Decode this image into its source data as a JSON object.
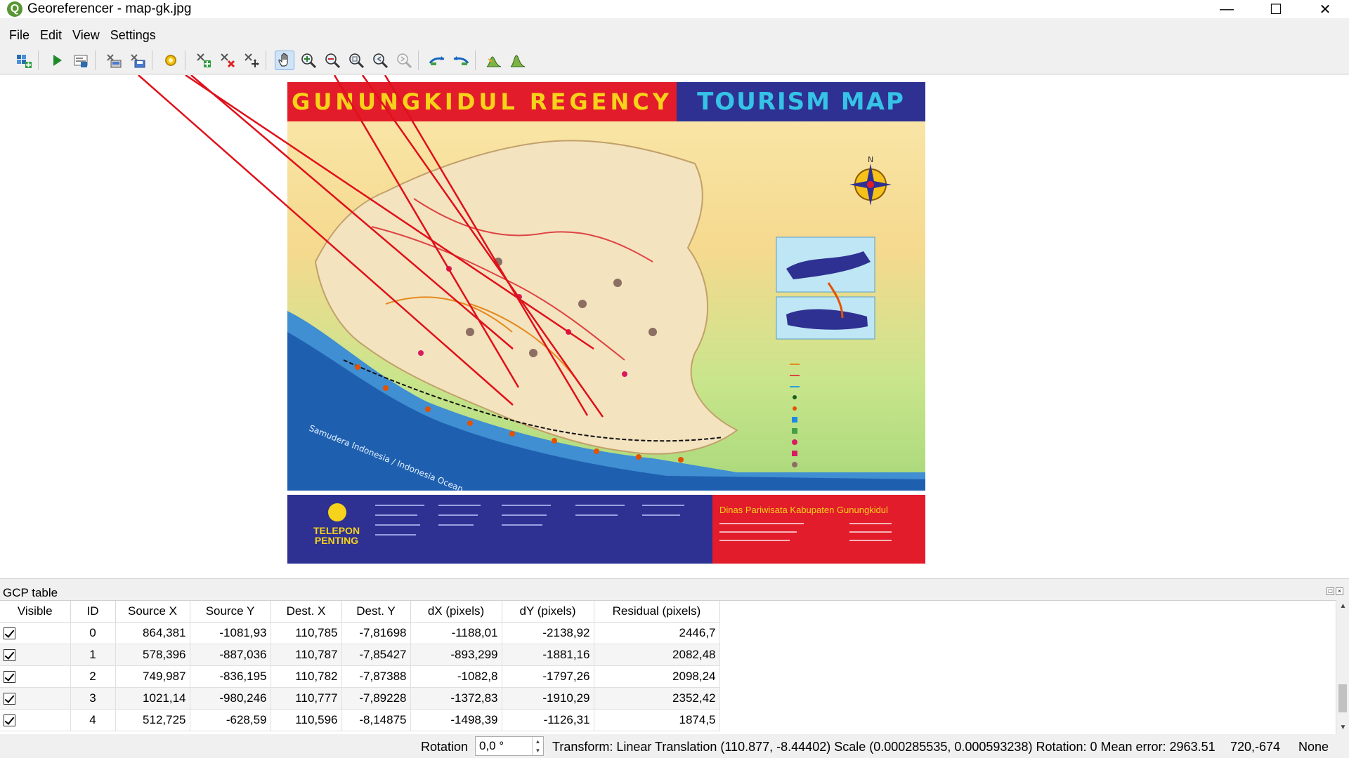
{
  "window": {
    "title": "Georeferencer - map-gk.jpg",
    "app_icon": "qgis-icon",
    "controls": [
      "minimize-icon",
      "maximize-icon",
      "close-icon"
    ]
  },
  "menu": [
    "File",
    "Edit",
    "View",
    "Settings"
  ],
  "toolbar": {
    "buttons": [
      "open-raster-icon",
      "start-georeferencing-icon",
      "generate-gdal-script-icon",
      "load-gcp-points-icon",
      "save-gcp-points-icon",
      "transformation-settings-icon",
      "add-point-icon",
      "delete-point-icon",
      "move-gcp-point-icon",
      "pan-icon",
      "zoom-in-icon",
      "zoom-out-icon",
      "zoom-to-layer-icon",
      "zoom-last-icon",
      "zoom-next-icon",
      "link-georef-to-qgis-icon",
      "link-qgis-to-georef-icon",
      "full-histogram-stretch-icon",
      "local-histogram-stretch-icon"
    ],
    "active": "pan-icon"
  },
  "map": {
    "title_left": "GUNUNGKIDUL REGENCY",
    "title_right": "TOURISM MAP",
    "telepon": "TELEPON PENTING",
    "dinas": "Dinas Pariwisata Kabupaten Gunungkidul",
    "ocean": "Samudera Indonesia / Indonesia Ocean",
    "compass": "N"
  },
  "gcp_table": {
    "title": "GCP table",
    "columns": [
      "Visible",
      "ID",
      "Source X",
      "Source Y",
      "Dest. X",
      "Dest. Y",
      "dX (pixels)",
      "dY (pixels)",
      "Residual (pixels)"
    ],
    "rows": [
      {
        "visible": true,
        "id": "0",
        "source_x": "864,381",
        "source_y": "-1081,93",
        "dest_x": "110,785",
        "dest_y": "-7,81698",
        "dx": "-1188,01",
        "dy": "-2138,92",
        "residual": "2446,7"
      },
      {
        "visible": true,
        "id": "1",
        "source_x": "578,396",
        "source_y": "-887,036",
        "dest_x": "110,787",
        "dest_y": "-7,85427",
        "dx": "-893,299",
        "dy": "-1881,16",
        "residual": "2082,48"
      },
      {
        "visible": true,
        "id": "2",
        "source_x": "749,987",
        "source_y": "-836,195",
        "dest_x": "110,782",
        "dest_y": "-7,87388",
        "dx": "-1082,8",
        "dy": "-1797,26",
        "residual": "2098,24"
      },
      {
        "visible": true,
        "id": "3",
        "source_x": "1021,14",
        "source_y": "-980,246",
        "dest_x": "110,777",
        "dest_y": "-7,89228",
        "dx": "-1372,83",
        "dy": "-1910,29",
        "residual": "2352,42"
      },
      {
        "visible": true,
        "id": "4",
        "source_x": "512,725",
        "source_y": "-628,59",
        "dest_x": "110,596",
        "dest_y": "-8,14875",
        "dx": "-1498,39",
        "dy": "-1126,31",
        "residual": "1874,5"
      }
    ]
  },
  "status": {
    "rotation_label": "Rotation",
    "rotation_value": "0,0 °",
    "transform": "Transform: Linear Translation (110.877, -8.44402) Scale (0.000285535, 0.000593238) Rotation: 0 Mean error: 2963.51",
    "coords": "720,-674",
    "crs": "None"
  },
  "colors": {
    "residual_line": "#e0101a",
    "map_red": "#e21c2a",
    "map_blue": "#2e3192",
    "title_yellow": "#f6d21a",
    "title_cyan": "#35c3e6"
  }
}
